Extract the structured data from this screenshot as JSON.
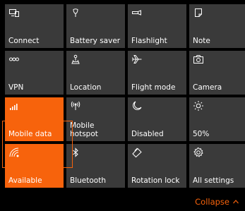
{
  "colors": {
    "accent": "#f7630c",
    "tile_bg": "#3a3a3a",
    "panel_bg": "#000000",
    "text": "#ffffff"
  },
  "tiles": [
    {
      "label": "Connect",
      "icon": "connect-icon",
      "active": false
    },
    {
      "label": "Battery saver",
      "icon": "battery-saver-icon",
      "active": false
    },
    {
      "label": "Flashlight",
      "icon": "flashlight-icon",
      "active": false
    },
    {
      "label": "Note",
      "icon": "note-icon",
      "active": false
    },
    {
      "label": "VPN",
      "icon": "vpn-icon",
      "active": false
    },
    {
      "label": "Location",
      "icon": "location-icon",
      "active": false
    },
    {
      "label": "Flight mode",
      "icon": "airplane-icon",
      "active": false
    },
    {
      "label": "Camera",
      "icon": "camera-icon",
      "active": false
    },
    {
      "label": "Mobile data",
      "icon": "signal-bars-icon",
      "active": true
    },
    {
      "label": "Mobile\nhotspot",
      "icon": "hotspot-icon",
      "active": false
    },
    {
      "label": "Disabled",
      "icon": "quiet-hours-moon-icon",
      "active": false
    },
    {
      "label": "50%",
      "icon": "brightness-sun-icon",
      "active": false
    },
    {
      "label": "Available",
      "icon": "wifi-icon",
      "active": true
    },
    {
      "label": "Bluetooth",
      "icon": "bluetooth-icon",
      "active": false
    },
    {
      "label": "Rotation lock",
      "icon": "rotation-lock-icon",
      "active": false
    },
    {
      "label": "All settings",
      "icon": "settings-gear-icon",
      "active": false
    }
  ],
  "footer": {
    "collapse_label": "Collapse",
    "collapse_icon": "chevron-up-icon"
  }
}
